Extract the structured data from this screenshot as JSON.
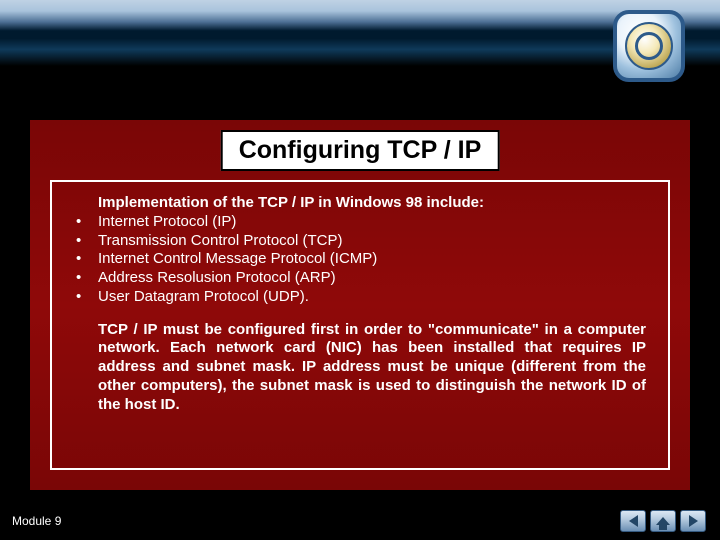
{
  "title": "Configuring TCP / IP",
  "lead": "Implementation of the TCP / IP in Windows 98 include:",
  "protocols": [
    "Internet Protocol (IP)",
    "Transmission Control Protocol (TCP)",
    "Internet Control Message Protocol (ICMP)",
    "Address Resolusion Protocol (ARP)",
    "User Datagram Protocol (UDP)."
  ],
  "paragraph": "TCP / IP must be configured first in order to \"communicate\" in a computer network. Each network card (NIC) has been installed that requires IP address and subnet mask. IP address must be unique (different from the other computers), the subnet mask is used to distinguish the network ID of the host ID.",
  "footer": "Module  9",
  "nav": {
    "prev": "previous",
    "home": "home",
    "next": "next"
  }
}
